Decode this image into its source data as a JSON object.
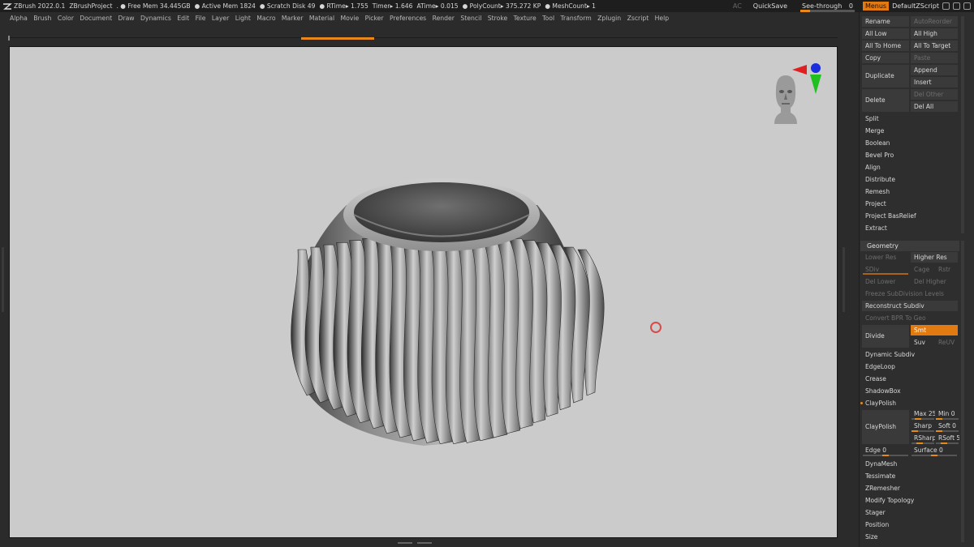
{
  "titlebar": {
    "app": "ZBrush 2022.0.1",
    "project": "ZBrushProject",
    "free_mem": ". ● Free Mem 34.445GB",
    "active_mem": "● Active Mem 1824",
    "scratch": "● Scratch Disk 49",
    "rtime": "●  RTime▸ 1.755",
    "timer": "Timer▸ 1.646",
    "atime": "ATime▸ 0.015",
    "polycount": "● PolyCount▸ 375.272 KP",
    "meshcount": "● MeshCount▸ 1",
    "ac": "AC",
    "quicksave": "QuickSave",
    "see_through": "See-through",
    "see_through_value": "0",
    "menus": "Menus",
    "default_zscript": "DefaultZScript"
  },
  "menubar": [
    "Alpha",
    "Brush",
    "Color",
    "Document",
    "Draw",
    "Dynamics",
    "Edit",
    "File",
    "Layer",
    "Light",
    "Macro",
    "Marker",
    "Material",
    "Movie",
    "Picker",
    "Preferences",
    "Render",
    "Stencil",
    "Stroke",
    "Texture",
    "Tool",
    "Transform",
    "Zplugin",
    "Zscript",
    "Help"
  ],
  "subtool": {
    "rename": "Rename",
    "autoreorder": "AutoReorder",
    "all_low": "All Low",
    "all_high": "All High",
    "all_to_home": "All To Home",
    "all_to_target": "All To Target",
    "copy": "Copy",
    "paste": "Paste",
    "duplicate": "Duplicate",
    "append": "Append",
    "insert": "Insert",
    "delete": "Delete",
    "del_other": "Del Other",
    "del_all": "Del All",
    "split": "Split",
    "merge": "Merge",
    "boolean": "Boolean",
    "bevel_pro": "Bevel Pro",
    "align": "Align",
    "distribute": "Distribute",
    "remesh": "Remesh",
    "project": "Project",
    "project_basrelief": "Project BasRelief",
    "extract": "Extract"
  },
  "geometry": {
    "header": "Geometry",
    "lower_res": "Lower Res",
    "higher_res": "Higher Res",
    "sdiv": "SDiv",
    "cage": "Cage",
    "rstr": "Rstr",
    "del_lower": "Del Lower",
    "del_higher": "Del Higher",
    "freeze": "Freeze SubDivision Levels",
    "reconstruct": "Reconstruct Subdiv",
    "convert_bpr": "Convert BPR To Geo",
    "divide": "Divide",
    "smt": "Smt",
    "suv": "Suv",
    "reuv": "ReUV",
    "dynamic_subdiv": "Dynamic Subdiv",
    "edgeloop": "EdgeLoop",
    "crease": "Crease",
    "shadowbox": "ShadowBox",
    "claypolish_hdr": "ClayPolish",
    "claypolish": "ClayPolish",
    "max": "Max 25",
    "min": "Min 0",
    "sharp": "Sharp",
    "soft": "Soft 0",
    "rsharp": "RSharp",
    "rsoft": "RSoft 5",
    "edge": "Edge 0",
    "surface": "Surface 0",
    "dynamesh": "DynaMesh",
    "tessimate": "Tessimate",
    "zremesher": "ZRemesher",
    "modify_topology": "Modify Topology",
    "stager": "Stager",
    "position": "Position",
    "size": "Size"
  },
  "colors": {
    "accent": "#e27a12",
    "canvas": "#cbcbcb",
    "panel": "#2e2e2e",
    "button": "#3a3a3a"
  }
}
